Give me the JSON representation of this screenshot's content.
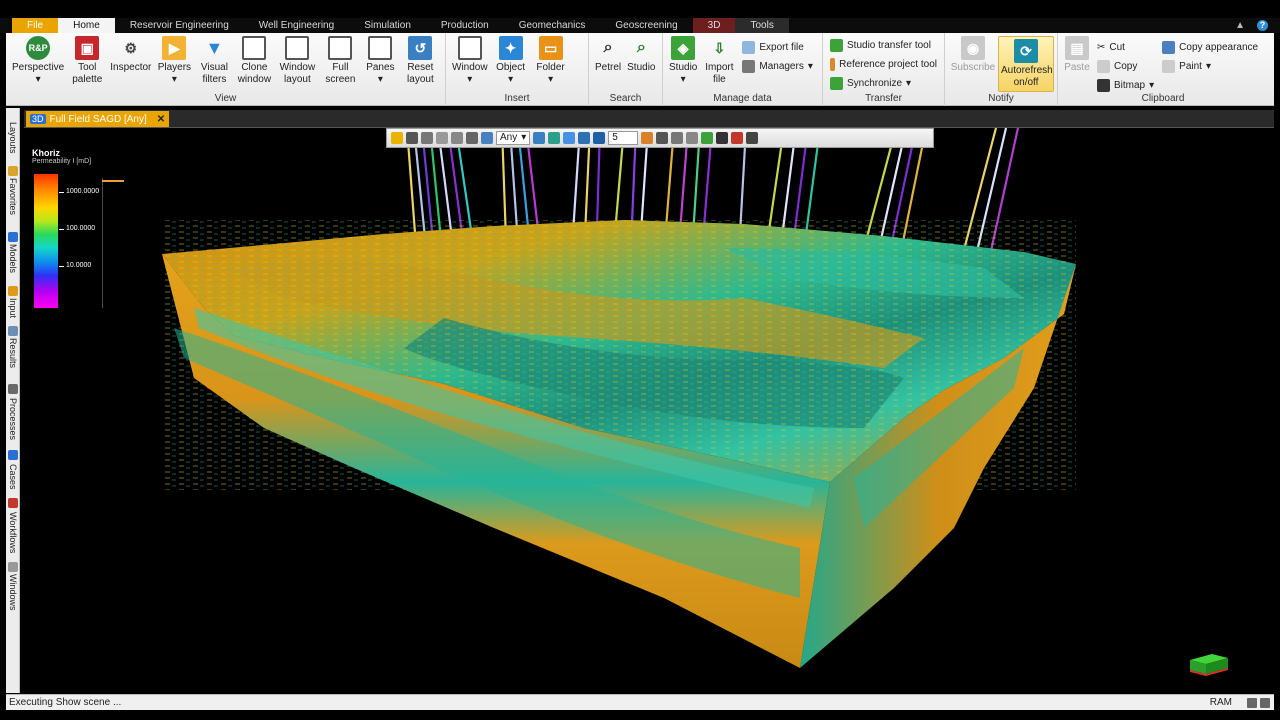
{
  "menubar": {
    "tabs": [
      {
        "label": "File",
        "style": "file"
      },
      {
        "label": "Home",
        "style": "active"
      },
      {
        "label": "Reservoir Engineering",
        "style": ""
      },
      {
        "label": "Well Engineering",
        "style": ""
      },
      {
        "label": "Simulation",
        "style": ""
      },
      {
        "label": "Production",
        "style": ""
      },
      {
        "label": "Geomechanics",
        "style": ""
      },
      {
        "label": "Geoscreening",
        "style": ""
      },
      {
        "label": "3D",
        "style": "ctx3d"
      },
      {
        "label": "Tools",
        "style": "tools"
      }
    ],
    "help_label": "?"
  },
  "ribbon": {
    "view": {
      "title": "View",
      "perspective": "Perspective",
      "perspective_icon": "R&P",
      "tool_palette": "Tool palette",
      "inspector": "Inspector",
      "players": "Players",
      "visual_filters": "Visual filters",
      "clone_window": "Clone window",
      "window_layout": "Window layout",
      "full_screen": "Full screen",
      "panes": "Panes",
      "reset_layout": "Reset layout"
    },
    "insert": {
      "title": "Insert",
      "window": "Window",
      "object": "Object",
      "folder": "Folder"
    },
    "search": {
      "title": "Search",
      "petrel": "Petrel",
      "studio": "Studio"
    },
    "manage": {
      "title": "Manage data",
      "studio": "Studio",
      "import_file": "Import file",
      "export_file": "Export file",
      "managers": "Managers"
    },
    "transfer": {
      "title": "Transfer",
      "studio_transfer": "Studio transfer tool",
      "reference_project": "Reference project tool",
      "synchronize": "Synchronize"
    },
    "notify": {
      "title": "Notify",
      "subscribe": "Subscribe",
      "autorefresh": "Autorefresh on/off"
    },
    "clipboard": {
      "title": "Clipboard",
      "paste": "Paste",
      "cut": "Cut",
      "copy": "Copy",
      "bitmap": "Bitmap",
      "copy_appearance": "Copy appearance",
      "paint": "Paint"
    }
  },
  "document": {
    "badge": "3D",
    "tab_label": "Full Field SAGD [Any]",
    "close": "✕"
  },
  "sidebar": {
    "tabs": [
      "Layouts",
      "Favorites",
      "Models",
      "Input",
      "Results",
      "Processes",
      "Cases",
      "Workflows",
      "Windows"
    ]
  },
  "viewer_toolbar": {
    "select_value": "Any",
    "number_value": "5"
  },
  "legend": {
    "title": "Khoriz",
    "subtitle": "Permeability I [mD]",
    "values": [
      "1000.0000",
      "100.0000",
      "10.0000"
    ]
  },
  "status": {
    "text": "Executing Show scene ...",
    "ram": "RAM"
  },
  "colors": {
    "accent": "#e9a400",
    "ribbon_bg": "#f4f4f4",
    "ctx_3d": "#6d1f1f"
  }
}
